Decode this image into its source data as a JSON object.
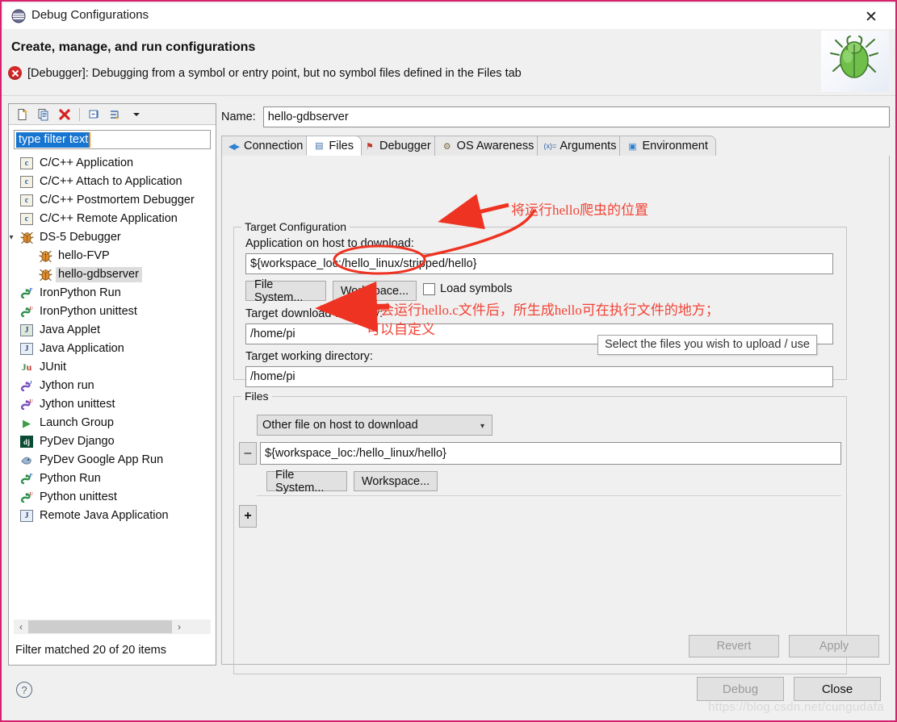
{
  "window": {
    "title": "Debug Configurations",
    "close_label": "✕",
    "header_title": "Create, manage, and run configurations",
    "error_message": "[Debugger]: Debugging from a symbol or entry point, but no symbol files defined in the Files tab",
    "watermark": "https://blog.csdn.net/cungudafa"
  },
  "tree_toolbar": {
    "buttons": [
      {
        "name": "new-configuration-icon",
        "label": "new"
      },
      {
        "name": "duplicate-configuration-icon",
        "label": "duplicate"
      },
      {
        "name": "delete-configuration-icon",
        "label": "delete"
      },
      {
        "name": "collapse-all-icon",
        "label": "collapse all"
      },
      {
        "name": "filter-icon",
        "label": "filter"
      },
      {
        "name": "view-menu-icon",
        "label": "menu"
      }
    ]
  },
  "filter": {
    "value": "type filter text",
    "status": "Filter matched 20 of 20 items"
  },
  "tree": {
    "items": [
      {
        "label": "C/C++ Application",
        "icon": "c-config-icon",
        "depth": 0,
        "twisty": "",
        "selected": false
      },
      {
        "label": "C/C++ Attach to Application",
        "icon": "c-config-icon",
        "depth": 0,
        "twisty": "",
        "selected": false
      },
      {
        "label": "C/C++ Postmortem Debugger",
        "icon": "c-config-icon",
        "depth": 0,
        "twisty": "",
        "selected": false
      },
      {
        "label": "C/C++ Remote Application",
        "icon": "c-config-icon",
        "depth": 0,
        "twisty": "",
        "selected": false
      },
      {
        "label": "DS-5 Debugger",
        "icon": "bug-icon",
        "depth": 0,
        "twisty": "▾",
        "selected": false
      },
      {
        "label": "hello-FVP",
        "icon": "bug-icon",
        "depth": 1,
        "twisty": "",
        "selected": false
      },
      {
        "label": "hello-gdbserver",
        "icon": "bug-icon",
        "depth": 1,
        "twisty": "",
        "selected": true
      },
      {
        "label": "IronPython Run",
        "icon": "python-run-icon",
        "depth": 0,
        "twisty": "",
        "selected": false
      },
      {
        "label": "IronPython unittest",
        "icon": "python-unittest-icon",
        "depth": 0,
        "twisty": "",
        "selected": false
      },
      {
        "label": "Java Applet",
        "icon": "java-applet-icon",
        "depth": 0,
        "twisty": "",
        "selected": false
      },
      {
        "label": "Java Application",
        "icon": "java-app-icon",
        "depth": 0,
        "twisty": "",
        "selected": false
      },
      {
        "label": "JUnit",
        "icon": "junit-icon",
        "depth": 0,
        "twisty": "",
        "selected": false
      },
      {
        "label": "Jython run",
        "icon": "jython-run-icon",
        "depth": 0,
        "twisty": "",
        "selected": false
      },
      {
        "label": "Jython unittest",
        "icon": "jython-unittest-icon",
        "depth": 0,
        "twisty": "",
        "selected": false
      },
      {
        "label": "Launch Group",
        "icon": "play-icon",
        "depth": 0,
        "twisty": "",
        "selected": false
      },
      {
        "label": "PyDev Django",
        "icon": "django-icon",
        "depth": 0,
        "twisty": "",
        "selected": false
      },
      {
        "label": "PyDev Google App Run",
        "icon": "google-app-icon",
        "depth": 0,
        "twisty": "",
        "selected": false
      },
      {
        "label": "Python Run",
        "icon": "python-run-icon",
        "depth": 0,
        "twisty": "",
        "selected": false
      },
      {
        "label": "Python unittest",
        "icon": "python-unittest-icon",
        "depth": 0,
        "twisty": "",
        "selected": false
      },
      {
        "label": "Remote Java Application",
        "icon": "remote-java-icon",
        "depth": 0,
        "twisty": "",
        "selected": false
      }
    ]
  },
  "config": {
    "name_label": "Name:",
    "name_value": "hello-gdbserver"
  },
  "tabs": [
    {
      "label": "Connection",
      "icon": "connection-icon",
      "glyph": "◀▸",
      "active": false
    },
    {
      "label": "Files",
      "icon": "files-icon",
      "glyph": "▤",
      "active": true
    },
    {
      "label": "Debugger",
      "icon": "debugger-icon",
      "glyph": "⚑",
      "active": false
    },
    {
      "label": "OS Awareness",
      "icon": "os-awareness-icon",
      "glyph": "⚙",
      "active": false
    },
    {
      "label": "Arguments",
      "icon": "arguments-icon",
      "glyph": "(x)=",
      "active": false
    },
    {
      "label": "Environment",
      "icon": "environment-icon",
      "glyph": "▣",
      "active": false
    }
  ],
  "target_configuration": {
    "group_label": "Target Configuration",
    "app_label": "Application on host to download:",
    "app_value": "${workspace_loc:/hello_linux/stripped/hello}",
    "file_system_button": "File System...",
    "workspace_button": "Workspace...",
    "load_symbols_label": "Load symbols",
    "load_symbols_checked": false,
    "download_dir_label": "Target download directory:",
    "download_dir_value": "/home/pi",
    "working_dir_label": "Target working directory:",
    "working_dir_value": "/home/pi"
  },
  "files": {
    "group_label": "Files",
    "combo_value": "Other file on host to download",
    "path_value": "${workspace_loc:/hello_linux/hello}",
    "file_system_button": "File System...",
    "workspace_button": "Workspace...",
    "remove_button": "–",
    "add_button": "+",
    "tooltip": "Select the files you wish to upload / use"
  },
  "buttons": {
    "revert": "Revert",
    "apply": "Apply",
    "debug": "Debug",
    "close": "Close",
    "help": "?"
  },
  "annotations": [
    {
      "text": "将运行hello爬虫的位置",
      "color": "#f24336"
    },
    {
      "text": "等会运行hello.c文件后，所生成hello可在执行文件的地方；",
      "color": "#f24336"
    },
    {
      "text": "可以自定义",
      "color": "#f24336"
    }
  ]
}
